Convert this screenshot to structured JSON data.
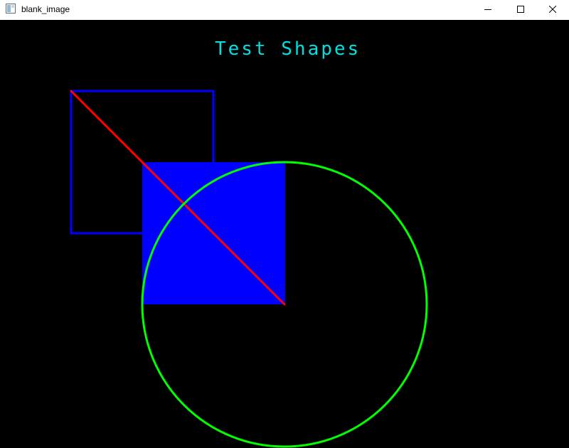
{
  "window": {
    "title": "blank_image",
    "icon": "window-app-icon",
    "controls": [
      {
        "name": "minimize",
        "icon": "minimize-icon"
      },
      {
        "name": "maximize",
        "icon": "maximize-icon"
      },
      {
        "name": "close",
        "icon": "close-icon"
      }
    ]
  },
  "canvas": {
    "background": "#000000",
    "text": {
      "content": "Test Shapes",
      "color": "#00e0e0"
    },
    "shapes": {
      "outline_rectangle": {
        "color": "#0000ff"
      },
      "filled_rectangle": {
        "color": "#0000ff"
      },
      "diagonal_line": {
        "color": "#ff0000"
      },
      "circle": {
        "color": "#00ff00"
      }
    }
  }
}
